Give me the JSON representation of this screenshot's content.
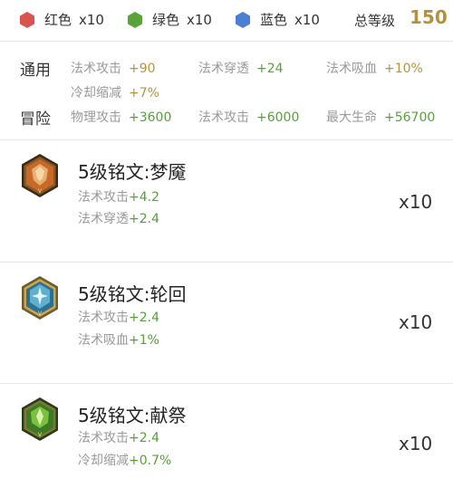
{
  "gems": [
    {
      "label": "红色",
      "count": "x10",
      "color": "#d9534f",
      "icon": "red-hexagon-icon"
    },
    {
      "label": "绿色",
      "count": "x10",
      "color": "#5aa33a",
      "icon": "green-hexagon-icon"
    },
    {
      "label": "蓝色",
      "count": "x10",
      "color": "#4a7fd4",
      "icon": "blue-hexagon-icon"
    }
  ],
  "total_level": {
    "label": "总等级",
    "value": "150"
  },
  "stats": {
    "general": {
      "label": "通用",
      "items": [
        {
          "name": "法术攻击",
          "value": "+90"
        },
        {
          "name": "法术穿透",
          "value": "+24"
        },
        {
          "name": "法术吸血",
          "value": "+10%"
        },
        {
          "name": "冷却缩减",
          "value": "+7%"
        }
      ]
    },
    "adventure": {
      "label": "冒险",
      "items": [
        {
          "name": "物理攻击",
          "value": "+3600"
        },
        {
          "name": "法术攻击",
          "value": "+6000"
        },
        {
          "name": "最大生命",
          "value": "+56700"
        }
      ]
    }
  },
  "runes": [
    {
      "name": "5级铭文:梦魇",
      "color": "red",
      "attrs": [
        {
          "name": "法术攻击",
          "value": "+4.2"
        },
        {
          "name": "法术穿透",
          "value": "+2.4"
        }
      ],
      "qty": "x10"
    },
    {
      "name": "5级铭文:轮回",
      "color": "blue",
      "attrs": [
        {
          "name": "法术攻击",
          "value": "+2.4"
        },
        {
          "name": "法术吸血",
          "value": "+1%"
        }
      ],
      "qty": "x10"
    },
    {
      "name": "5级铭文:献祭",
      "color": "green",
      "attrs": [
        {
          "name": "法术攻击",
          "value": "+2.4"
        },
        {
          "name": "冷却缩减",
          "value": "+0.7%"
        }
      ],
      "qty": "x10"
    }
  ]
}
